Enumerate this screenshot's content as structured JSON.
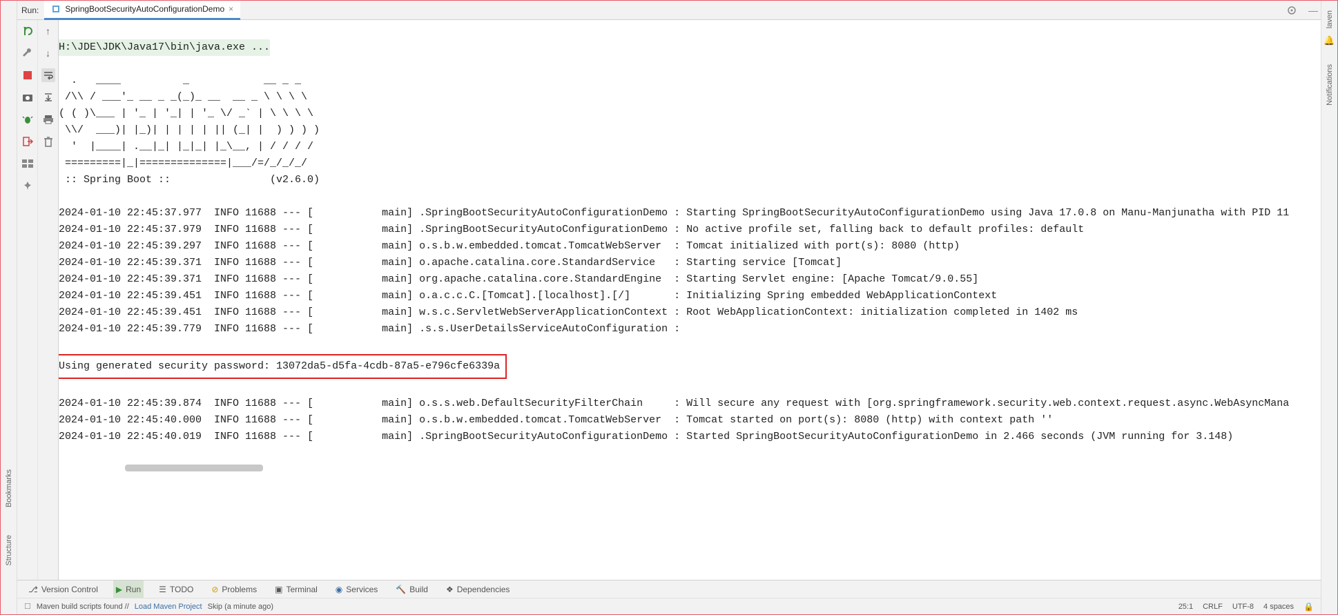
{
  "header": {
    "run_label": "Run:",
    "tab_name": "SpringBootSecurityAutoConfigurationDemo"
  },
  "right_gutter": {
    "top_label": "laven",
    "notifications": "Notifications"
  },
  "left_gutter": {
    "bookmarks": "Bookmarks",
    "structure": "Structure"
  },
  "console": {
    "command": "H:\\JDE\\JDK\\Java17\\bin\\java.exe ...",
    "banner": "  .   ____          _            __ _ _\n /\\\\ / ___'_ __ _ _(_)_ __  __ _ \\ \\ \\ \\\n( ( )\\___ | '_ | '_| | '_ \\/ _` | \\ \\ \\ \\\n \\\\/  ___)| |_)| | | | | || (_| |  ) ) ) )\n  '  |____| .__|_| |_|_| |_\\__, | / / / /\n =========|_|==============|___/=/_/_/_/\n :: Spring Boot ::                (v2.6.0)",
    "lines": [
      "2024-01-10 22:45:37.977  INFO 11688 --- [           main] .SpringBootSecurityAutoConfigurationDemo : Starting SpringBootSecurityAutoConfigurationDemo using Java 17.0.8 on Manu-Manjunatha with PID 11",
      "2024-01-10 22:45:37.979  INFO 11688 --- [           main] .SpringBootSecurityAutoConfigurationDemo : No active profile set, falling back to default profiles: default",
      "2024-01-10 22:45:39.297  INFO 11688 --- [           main] o.s.b.w.embedded.tomcat.TomcatWebServer  : Tomcat initialized with port(s): 8080 (http)",
      "2024-01-10 22:45:39.371  INFO 11688 --- [           main] o.apache.catalina.core.StandardService   : Starting service [Tomcat]",
      "2024-01-10 22:45:39.371  INFO 11688 --- [           main] org.apache.catalina.core.StandardEngine  : Starting Servlet engine: [Apache Tomcat/9.0.55]",
      "2024-01-10 22:45:39.451  INFO 11688 --- [           main] o.a.c.c.C.[Tomcat].[localhost].[/]       : Initializing Spring embedded WebApplicationContext",
      "2024-01-10 22:45:39.451  INFO 11688 --- [           main] w.s.c.ServletWebServerApplicationContext : Root WebApplicationContext: initialization completed in 1402 ms",
      "2024-01-10 22:45:39.779  INFO 11688 --- [           main] .s.s.UserDetailsServiceAutoConfiguration :"
    ],
    "highlight": "Using generated security password: 13072da5-d5fa-4cdb-87a5-e796cfe6339a",
    "lines_after": [
      "2024-01-10 22:45:39.874  INFO 11688 --- [           main] o.s.s.web.DefaultSecurityFilterChain     : Will secure any request with [org.springframework.security.web.context.request.async.WebAsyncMana",
      "2024-01-10 22:45:40.000  INFO 11688 --- [           main] o.s.b.w.embedded.tomcat.TomcatWebServer  : Tomcat started on port(s): 8080 (http) with context path ''",
      "2024-01-10 22:45:40.019  INFO 11688 --- [           main] .SpringBootSecurityAutoConfigurationDemo : Started SpringBootSecurityAutoConfigurationDemo in 2.466 seconds (JVM running for 3.148)"
    ]
  },
  "bottom_tabs": {
    "version_control": "Version Control",
    "run": "Run",
    "todo": "TODO",
    "problems": "Problems",
    "terminal": "Terminal",
    "services": "Services",
    "build": "Build",
    "dependencies": "Dependencies"
  },
  "status": {
    "message": "Maven build scripts found //",
    "load_link": "Load Maven Project",
    "skip": "Skip (a minute ago)",
    "pos": "25:1",
    "line_sep": "CRLF",
    "encoding": "UTF-8",
    "indent": "4 spaces"
  }
}
